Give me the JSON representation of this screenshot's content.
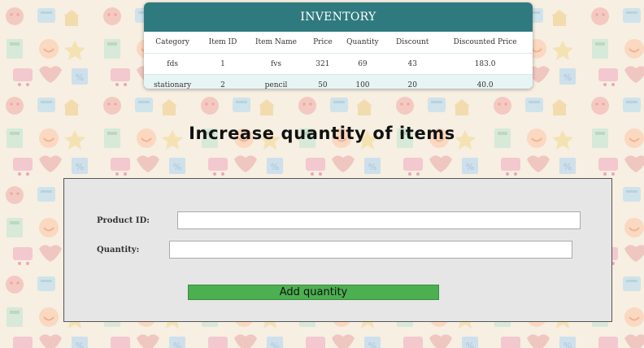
{
  "inventory": {
    "title": "INVENTORY",
    "columns": [
      "Category",
      "Item ID",
      "Item Name",
      "Price",
      "Quantity",
      "Discount",
      "Discounted Price"
    ],
    "rows": [
      [
        "fds",
        "1",
        "fvs",
        "321",
        "69",
        "43",
        "183.0"
      ],
      [
        "stationary",
        "2",
        "pencil",
        "50",
        "100",
        "20",
        "40.0"
      ]
    ]
  },
  "heading": "Increase quantity of items",
  "form": {
    "product_id_label": "Product ID:",
    "product_id_value": "",
    "quantity_label": "Quantity:",
    "quantity_value": "",
    "submit_label": "Add quantity"
  },
  "colors": {
    "header_teal": "#2f7a7e",
    "row_alt": "#e7f4f4",
    "button_green": "#4caf50",
    "panel_gray": "#e6e6e6"
  }
}
